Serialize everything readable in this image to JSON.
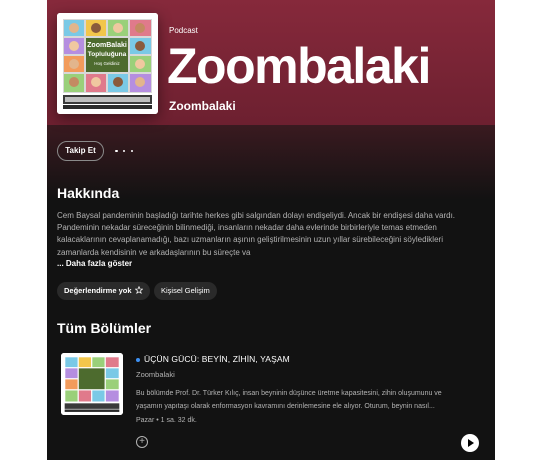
{
  "header": {
    "type": "Podcast",
    "title": "Zoombalaki",
    "author": "Zoombalaki",
    "cover_text": [
      "ZoomBalaki",
      "Topluluğuna",
      "Hoş Geldiniz"
    ]
  },
  "actions": {
    "follow": "Takip Et"
  },
  "about": {
    "heading": "Hakkında",
    "text": "Cem Baysal pandeminin başladığı tarihte herkes gibi salgından dolayı endişeliydi. Ancak bir endişesi daha vardı. Pandeminin nekadar süreceğinin bilinmediği, insanların nekadar daha evlerinde birbirleriyle temas etmeden kalacaklarının cevaplanamadığı, bazı uzmanların aşının geliştirilmesinin uzun yıllar sürebileceğini söyledikleri zamanlarda kendisinin ve arkadaşlarının bu süreçte va",
    "show_more": "... Daha fazla göster",
    "rating": "Değerlendirme yok",
    "category": "Kişisel Gelişim"
  },
  "episodes": {
    "heading": "Tüm Bölümler",
    "items": [
      {
        "title": "ÜÇÜN GÜCÜ: BEYİN, ZİHİN, YAŞAM",
        "show": "Zoombalaki",
        "description": "Bu bölümde Prof. Dr. Türker Kılıç, insan beyninin düşünce üretme kapasitesini, zihin oluşumunu ve yaşamın yapıtaşı olarak enformasyon kavramını derinlemesine ele alıyor. Oturum, beynin nasıl...",
        "meta": "Pazar • 1 sa. 32 dk."
      }
    ]
  },
  "colors": {
    "hero": "#86293b",
    "background": "#121212",
    "new_dot": "#3d91f4"
  }
}
